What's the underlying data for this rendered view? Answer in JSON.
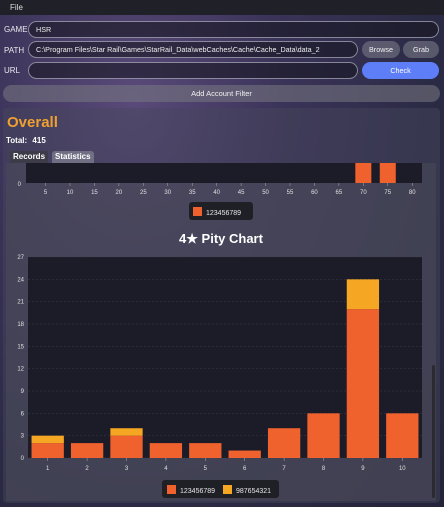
{
  "menu": {
    "file_label": "File"
  },
  "form": {
    "game_label": "GAME",
    "game_value": "HSR",
    "path_label": "PATH",
    "path_value": "C:\\Program Files\\Star Rail\\Games\\StarRail_Data\\webCaches\\Cache\\Cache_Data\\data_2",
    "url_label": "URL",
    "url_value": "",
    "browse_label": "Browse",
    "grab_label": "Grab",
    "check_label": "Check",
    "add_filter_label": "Add Account Filter"
  },
  "summary": {
    "title": "Overall",
    "total_label": "Total:",
    "total_value": "415"
  },
  "tabs": [
    {
      "label": "Records",
      "active": false
    },
    {
      "label": "Statistics",
      "active": true
    }
  ],
  "colors": {
    "series1": "#f0622d",
    "series2": "#f5a623",
    "accent": "#f0a030",
    "check": "#5e7ef8"
  },
  "chart_data": [
    {
      "type": "bar",
      "title": "",
      "partial": true,
      "x_ticks": [
        5,
        10,
        15,
        20,
        25,
        30,
        35,
        40,
        45,
        50,
        55,
        60,
        65,
        70,
        75,
        80
      ],
      "y_ticks": [
        0
      ],
      "series": [
        {
          "name": "123456789",
          "color": "#f0622d",
          "x": [
            70,
            75
          ],
          "values": [
            1,
            1
          ]
        }
      ],
      "legend_position": "bottom"
    },
    {
      "type": "bar",
      "stacked": true,
      "title": "4★ Pity Chart",
      "categories": [
        "1",
        "2",
        "3",
        "4",
        "5",
        "6",
        "7",
        "8",
        "9",
        "10"
      ],
      "ylim": [
        0,
        27
      ],
      "y_ticks": [
        0,
        3,
        6,
        9,
        12,
        15,
        18,
        21,
        24,
        27
      ],
      "series": [
        {
          "name": "123456789",
          "color": "#f0622d",
          "values": [
            2,
            2,
            3,
            2,
            2,
            1,
            4,
            6,
            20,
            6
          ]
        },
        {
          "name": "987654321",
          "color": "#f5a623",
          "values": [
            1,
            0,
            1,
            0,
            0,
            0,
            0,
            0,
            4,
            0
          ]
        }
      ],
      "legend_position": "bottom"
    }
  ]
}
